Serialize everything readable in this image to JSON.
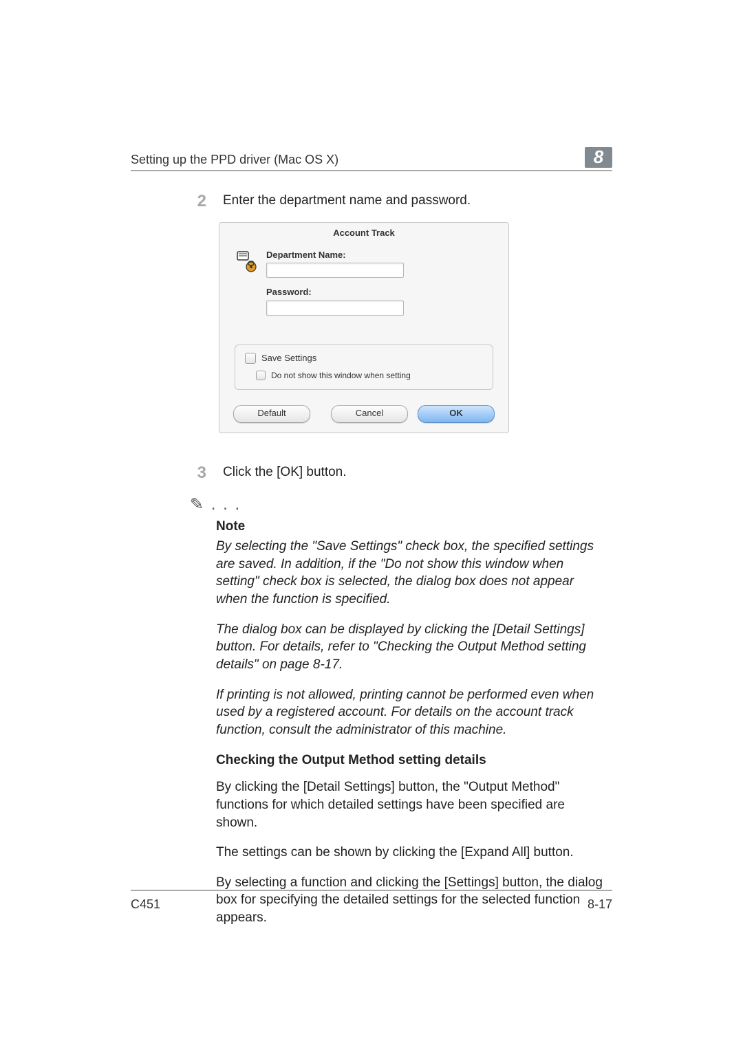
{
  "header": {
    "title": "Setting up the PPD driver (Mac OS X)",
    "chapter": "8"
  },
  "steps": {
    "s2": {
      "num": "2",
      "text": "Enter the department name and password."
    },
    "s3": {
      "num": "3",
      "text": "Click the [OK] button."
    }
  },
  "dialog": {
    "title": "Account Track",
    "deptLabel": "Department Name:",
    "deptValue": "",
    "passLabel": "Password:",
    "passValue": "",
    "saveSettings": "Save Settings",
    "doNotShow": "Do not show this window when setting",
    "defaultBtn": "Default",
    "cancelBtn": "Cancel",
    "okBtn": "OK"
  },
  "note": {
    "symbol": "✎ . . .",
    "label": "Note",
    "p1": "By selecting the \"Save Settings\" check box, the specified settings are saved. In addition, if the \"Do not show this window when setting\" check box is selected, the dialog box does not appear when the function is specified.",
    "p2": "The dialog box can be displayed by clicking the [Detail Settings] button. For details, refer to \"Checking the Output Method setting details\" on page 8-17.",
    "p3": "If printing is not allowed, printing cannot be performed even when used by a registered account. For details on the account track function, consult the administrator of this machine."
  },
  "section": {
    "heading": "Checking the Output Method setting details",
    "p1": "By clicking the [Detail Settings] button, the \"Output Method\" functions for which detailed settings have been specified are shown.",
    "p2": "The settings can be shown by clicking the [Expand All] button.",
    "p3": "By selecting a function and clicking the [Settings] button, the dialog box for specifying the detailed settings for the selected function appears."
  },
  "footer": {
    "model": "C451",
    "page": "8-17"
  }
}
